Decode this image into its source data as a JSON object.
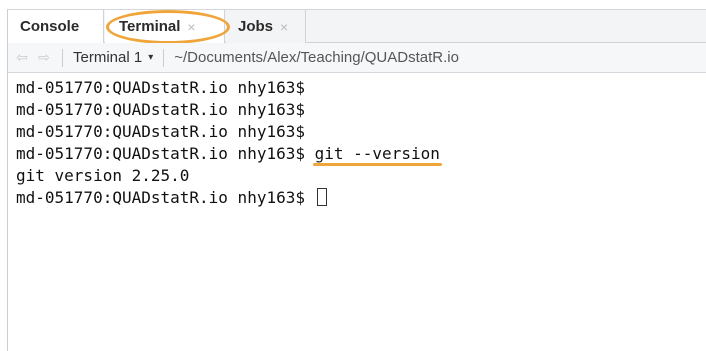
{
  "tabs": [
    {
      "label": "Console"
    },
    {
      "label": "Terminal",
      "close": "×"
    },
    {
      "label": "Jobs",
      "close": "×"
    }
  ],
  "toolbar": {
    "back_icon": "⇦",
    "forward_icon": "⇨",
    "terminal_selector": "Terminal 1",
    "caret": "▾",
    "path": "~/Documents/Alex/Teaching/QUADstatR.io"
  },
  "terminal": {
    "prompt": "md-051770:QUADstatR.io nhy163$",
    "command": "git --version",
    "output": "git version 2.25.0"
  },
  "colors": {
    "highlight": "#f0a53a"
  }
}
